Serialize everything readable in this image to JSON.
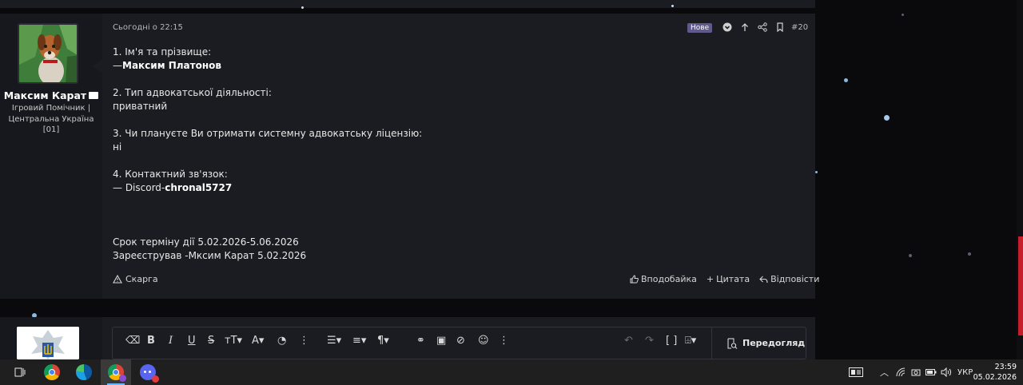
{
  "post": {
    "user": {
      "name": "Максим Карат",
      "title_lines": [
        "Ігровий Помічник |",
        "Центральна Україна",
        "[01]"
      ]
    },
    "date": "Сьогодні о 22:15",
    "badge": "Нове",
    "number": "#20",
    "header_icons": [
      "check-circle-icon",
      "arrow-up-icon",
      "share-icon",
      "bookmark-icon"
    ],
    "body": {
      "q1": "1. Ім'я та прізвище:",
      "a1_prefix": "—",
      "a1": "Максим Платонов",
      "q2": "2. Тип адвокатської діяльності:",
      "a2": "приватний",
      "q3": "3. Чи плануєте Ви отримати системну адвокатську ліцензію:",
      "a3": "ні",
      "q4": "4. Контактний зв'язок:",
      "a4_prefix": "— Discord-",
      "a4": "chronal5727",
      "term": "Срок терміну дії 5.02.2026-5.06.2026",
      "registered": "Зареєстрував -Мксим Карат 5.02.2026"
    },
    "actions": {
      "report": "Скарга",
      "like": "Вподобайка",
      "quote": "Цитата",
      "reply": "Відповісти"
    }
  },
  "editor": {
    "preview_label": "Передогляд"
  },
  "taskbar": {
    "apps": [
      "task-view-icon",
      "chrome-icon",
      "edge-icon",
      "chrome-profile-icon",
      "discord-icon"
    ],
    "language": "УКР",
    "time": "23:59",
    "date": "05.02.2026"
  },
  "colors": {
    "page_bg": "#0a0a0c",
    "post_bg": "#1b1c22",
    "badge": "#5e5a8a",
    "accent": "#c61f2b"
  }
}
